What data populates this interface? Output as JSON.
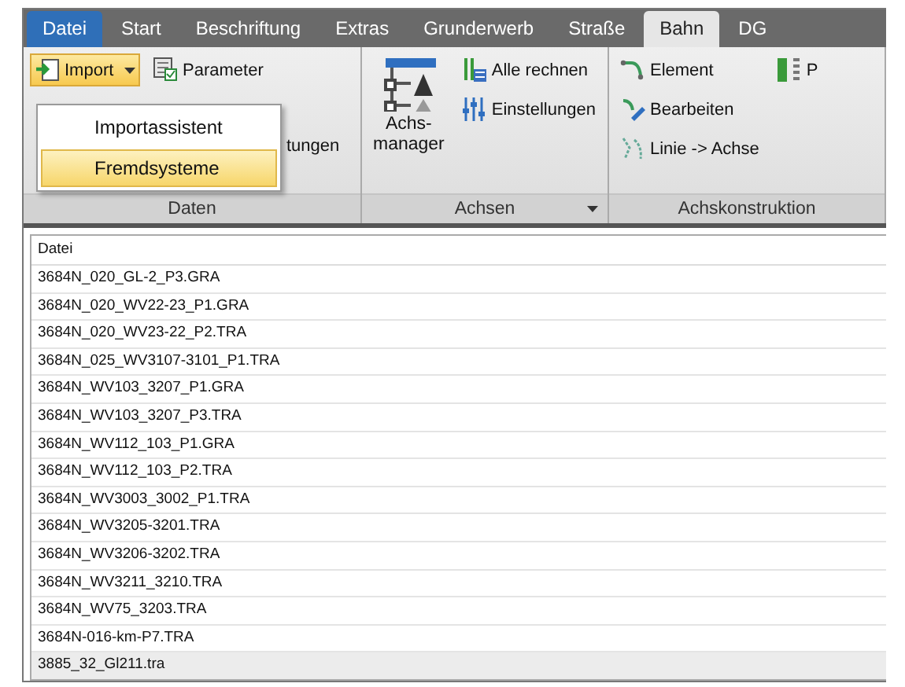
{
  "tabs": [
    {
      "label": "Datei",
      "kind": "file",
      "selected": false
    },
    {
      "label": "Start",
      "kind": "tab",
      "selected": false
    },
    {
      "label": "Beschriftung",
      "kind": "tab",
      "selected": false
    },
    {
      "label": "Extras",
      "kind": "tab",
      "selected": false
    },
    {
      "label": "Grunderwerb",
      "kind": "tab",
      "selected": false
    },
    {
      "label": "Straße",
      "kind": "tab",
      "selected": false
    },
    {
      "label": "Bahn",
      "kind": "tab",
      "selected": true
    },
    {
      "label": "DG",
      "kind": "tab",
      "selected": false
    }
  ],
  "ribbon": {
    "groups": [
      {
        "title": "Daten",
        "launcher": false,
        "columns": [
          [
            {
              "label": "Import",
              "kind": "split",
              "expanded": true
            }
          ],
          [
            {
              "label": "Parameter",
              "kind": "small"
            },
            {
              "label": "tungen",
              "kind": "partial"
            }
          ]
        ]
      },
      {
        "title": "Achsen",
        "launcher": true,
        "columns": [
          [
            {
              "label": "Achs-\nmanager",
              "kind": "large"
            }
          ],
          [
            {
              "label": "Alle rechnen",
              "kind": "small"
            },
            {
              "label": "Einstellungen",
              "kind": "small"
            }
          ]
        ]
      },
      {
        "title": "Achskonstruktion",
        "launcher": false,
        "columns": [
          [
            {
              "label": "Element",
              "kind": "small"
            },
            {
              "label": "Bearbeiten",
              "kind": "small"
            },
            {
              "label": "Linie -> Achse",
              "kind": "small"
            }
          ],
          [
            {
              "label": "P",
              "kind": "small"
            }
          ]
        ]
      }
    ]
  },
  "import_menu": [
    {
      "label": "Importassistent",
      "selected": false
    },
    {
      "label": "Fremdsysteme",
      "selected": true
    }
  ],
  "file_list": {
    "header": "Datei",
    "rows": [
      {
        "name": "3684N_020_GL-2_P3.GRA",
        "selected": false
      },
      {
        "name": "3684N_020_WV22-23_P1.GRA",
        "selected": false
      },
      {
        "name": "3684N_020_WV23-22_P2.TRA",
        "selected": false
      },
      {
        "name": "3684N_025_WV3107-3101_P1.TRA",
        "selected": false
      },
      {
        "name": "3684N_WV103_3207_P1.GRA",
        "selected": false
      },
      {
        "name": "3684N_WV103_3207_P3.TRA",
        "selected": false
      },
      {
        "name": "3684N_WV112_103_P1.GRA",
        "selected": false
      },
      {
        "name": "3684N_WV112_103_P2.TRA",
        "selected": false
      },
      {
        "name": "3684N_WV3003_3002_P1.TRA",
        "selected": false
      },
      {
        "name": "3684N_WV3205-3201.TRA",
        "selected": false
      },
      {
        "name": "3684N_WV3206-3202.TRA",
        "selected": false
      },
      {
        "name": "3684N_WV3211_3210.TRA",
        "selected": false
      },
      {
        "name": "3684N_WV75_3203.TRA",
        "selected": false
      },
      {
        "name": "3684N-016-km-P7.TRA",
        "selected": false
      },
      {
        "name": "3885_32_Gl211.tra",
        "selected": true
      }
    ]
  }
}
